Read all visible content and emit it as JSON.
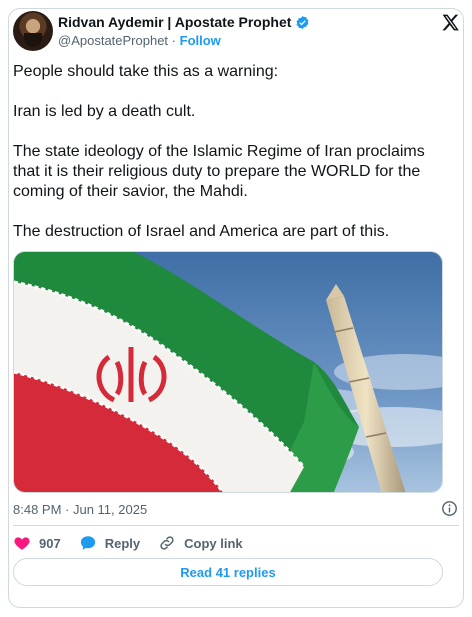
{
  "author": {
    "name": "Ridvan Aydemir | Apostate Prophet",
    "handle": "@ApostateProphet",
    "separator": "·",
    "follow_label": "Follow"
  },
  "tweet": {
    "paragraphs": [
      "People should take this as a warning:",
      "Iran is led by a death cult.",
      "The state ideology of the Islamic Regime of Iran proclaims that it is their religious duty to prepare the WORLD for the coming of their savior, the Mahdi.",
      "The destruction of Israel and America are part of this."
    ],
    "timestamp": "8:48 PM · Jun 11, 2025"
  },
  "actions": {
    "like_count": "907",
    "reply_label": "Reply",
    "copy_link_label": "Copy link",
    "read_replies_label": "Read 41 replies"
  },
  "icons": {
    "verified": "verified-badge-icon",
    "brand": "x-logo-icon",
    "info": "info-icon",
    "like": "heart-icon",
    "reply": "reply-bubble-icon",
    "copy": "link-icon"
  },
  "colors": {
    "accent": "#1d9bf0",
    "like": "#f91880",
    "secondary_text": "#536471",
    "border": "#cfd9de"
  }
}
